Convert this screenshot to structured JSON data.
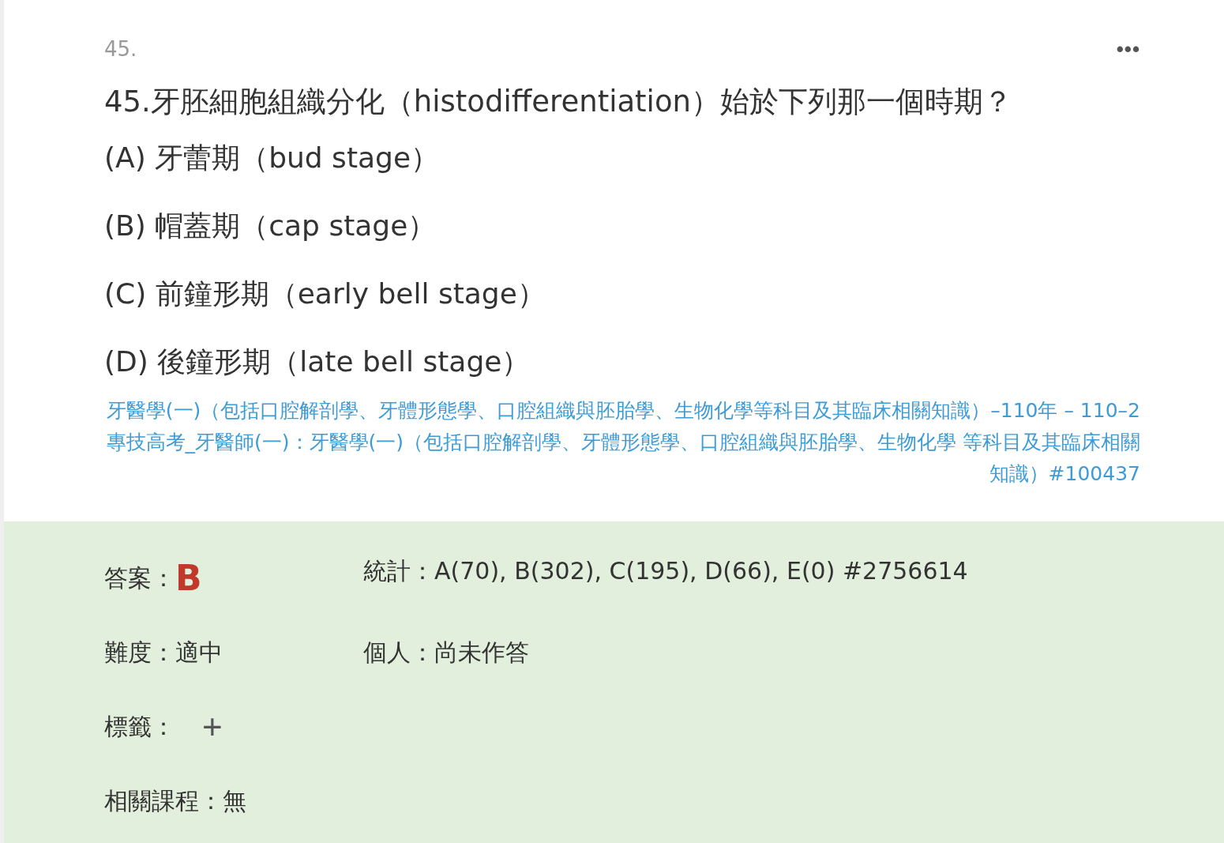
{
  "question": {
    "number": "45.",
    "text": "45.牙胚細胞組織分化（histodifferentiation）始於下列那一個時期？",
    "more_menu": "•••"
  },
  "options": [
    {
      "label": "(A) 牙蕾期（bud stage）"
    },
    {
      "label": "(B) 帽蓋期（cap stage）"
    },
    {
      "label": "(C) 前鐘形期（early bell stage）"
    },
    {
      "label": "(D) 後鐘形期（late bell stage）"
    }
  ],
  "source": "牙醫學(一)（包括口腔解剖學、牙體形態學、口腔組織與胚胎學、生物化學等科目及其臨床相關知識）–110年 – 110–2 專技高考_牙醫師(一)：牙醫學(一)（包括口腔解剖學、牙體形態學、口腔組織與胚胎學、生物化學 等科目及其臨床相關知識）#100437",
  "info": {
    "answer_label": "答案：",
    "answer": "B",
    "stats": "統計：A(70), B(302), C(195), D(66), E(0) #2756614",
    "difficulty": "難度：適中",
    "personal": "個人：尚未作答",
    "tags_label": "標籤：",
    "tags_add": "+",
    "courses": "相關課程：無"
  }
}
